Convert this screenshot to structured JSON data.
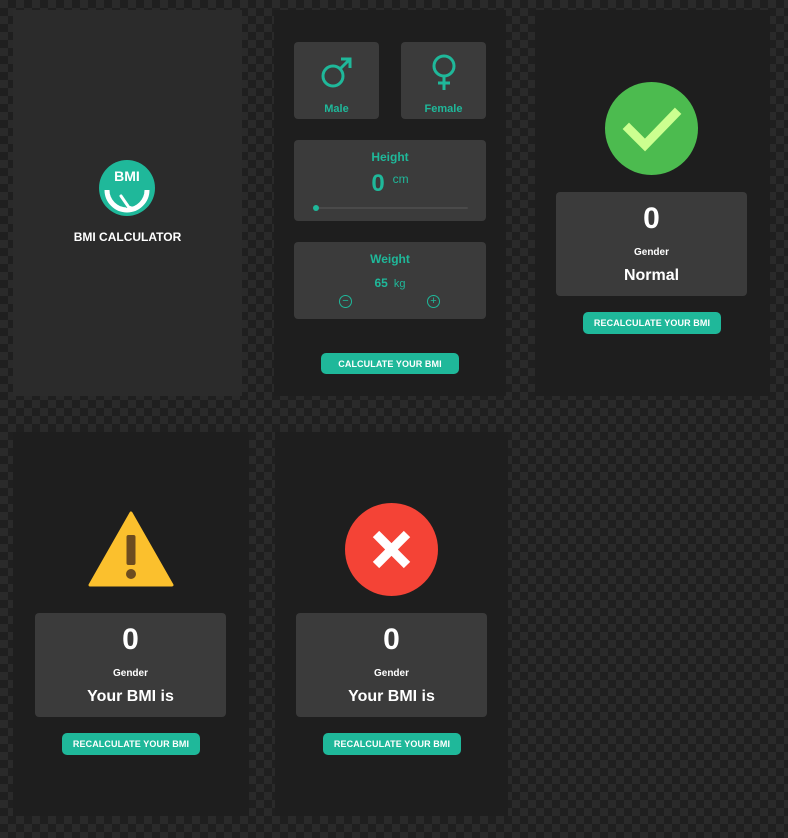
{
  "splash": {
    "logo_text": "BMI",
    "title": "BMI CALCULATOR"
  },
  "input": {
    "gender_male": "Male",
    "gender_female": "Female",
    "height_label": "Height",
    "height_value": "0",
    "height_unit": "cm",
    "height_slider_fraction": 0,
    "weight_label": "Weight",
    "weight_value": "65",
    "weight_unit": "kg",
    "decrement_symbol": "−",
    "increment_symbol": "+",
    "calculate_label": "CALCULATE YOUR BMI"
  },
  "result_normal": {
    "icon": "check-icon",
    "value": "0",
    "gender_label": "Gender",
    "status": "Normal",
    "recalculate_label": "RECALCULATE YOUR BMI"
  },
  "result_warning": {
    "icon": "warning-icon",
    "value": "0",
    "gender_label": "Gender",
    "status": "Your BMI is",
    "recalculate_label": "RECALCULATE YOUR BMI"
  },
  "result_error": {
    "icon": "error-icon",
    "value": "0",
    "gender_label": "Gender",
    "status": "Your BMI is",
    "recalculate_label": "RECALCULATE YOUR BMI"
  },
  "colors": {
    "accent": "#1fb89a",
    "card": "#3b3b3b",
    "success": "#4cbb4f",
    "warning": "#fbc02d",
    "error": "#f44336"
  }
}
